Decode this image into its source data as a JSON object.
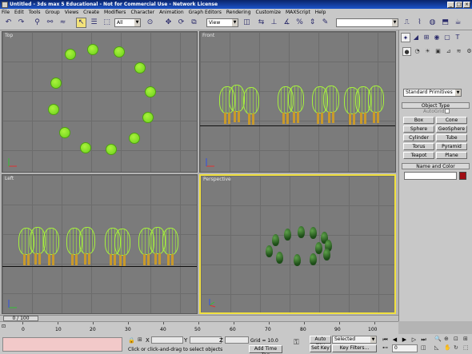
{
  "window": {
    "title": "Untitled - 3ds max 5 Educational - Not for Commercial Use - Network License"
  },
  "menu": [
    "File",
    "Edit",
    "Tools",
    "Group",
    "Views",
    "Create",
    "Modifiers",
    "Character",
    "Animation",
    "Graph Editors",
    "Rendering",
    "Customize",
    "MAXScript",
    "Help"
  ],
  "toolbar": {
    "selection_filter": "All",
    "reference_coord": "View"
  },
  "viewports": {
    "top": "Top",
    "front": "Front",
    "left": "Left",
    "perspective": "Perspective"
  },
  "command_panel": {
    "category": "Standard Primitives",
    "object_type_title": "Object Type",
    "autogrid_label": "AutoGrid",
    "buttons": [
      "Box",
      "Cone",
      "Sphere",
      "GeoSphere",
      "Cylinder",
      "Tube",
      "Torus",
      "Pyramid",
      "Teapot",
      "Plane"
    ],
    "name_color_title": "Name and Color",
    "color": "#a00d14"
  },
  "timeline": {
    "slider_label": "0 / 100",
    "ticks": [
      "0",
      "10",
      "20",
      "30",
      "40",
      "50",
      "60",
      "70",
      "80",
      "90",
      "100"
    ]
  },
  "status": {
    "prompt": "Click or click-and-drag to select objects",
    "x_label": "X",
    "y_label": "Y",
    "z_label": "Z",
    "grid": "Grid = 10.0",
    "add_time_tag": "Add Time Tag",
    "auto_key": "Auto Key",
    "set_key": "Set Key",
    "key_selection": "Selected",
    "key_filters": "Key Filters...",
    "current_frame": "0"
  }
}
